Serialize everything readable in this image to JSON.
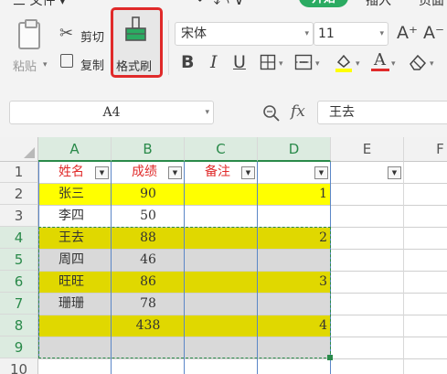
{
  "menu": {
    "file": "三 文件 ▾",
    "start": "开始",
    "insert": "插入",
    "layout": "页面"
  },
  "ribbon": {
    "paste": "粘贴",
    "cut": "剪切",
    "copy": "复制",
    "format_painter": "格式刷",
    "font_name": "宋体",
    "font_size": "11",
    "increase_font": "A⁺",
    "decrease_font": "A⁻",
    "bold": "B",
    "italic": "I",
    "underline": "U",
    "font_color_letter": "A"
  },
  "formula_bar": {
    "name_box": "A4",
    "fx": "fx",
    "formula_value": "王去"
  },
  "columns": [
    "A",
    "B",
    "C",
    "D",
    "E",
    "F"
  ],
  "rows": [
    "1",
    "2",
    "3",
    "4",
    "5",
    "6",
    "7",
    "8",
    "9",
    "10"
  ],
  "cells": {
    "A1": "姓名",
    "B1": "成绩",
    "C1": "备注",
    "A2": "张三",
    "B2": "90",
    "D2": "1",
    "A3": "李四",
    "B3": "50",
    "A4": "王去",
    "B4": "88",
    "D4": "2",
    "A5": "周四",
    "B5": "46",
    "A6": "旺旺",
    "B6": "86",
    "D6": "3",
    "A7": "珊珊",
    "B7": "78",
    "B8": "438",
    "D8": "4"
  },
  "colors": {
    "yellow": "#ffff00",
    "olive_yellow": "#e0d800",
    "gray": "#d9d9d9",
    "header_red": "#e02a2a",
    "accent_green": "#2a8a4a",
    "tab_green": "#2bab62"
  }
}
